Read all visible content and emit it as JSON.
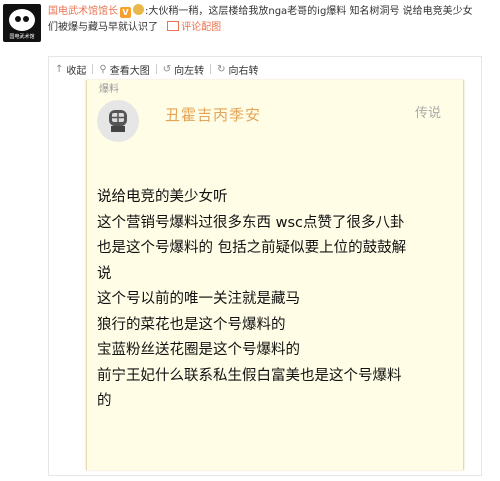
{
  "post": {
    "avatar_caption": "国电武术馆",
    "username": "国电武术馆馆长",
    "verified_badge": "V",
    "crown_icon": "crown-icon",
    "text_line1": ":大伙稍一稍，这层楼给我放nga老哥的ig爆料 知名树洞号 说给电竞美少女",
    "text_line2": "们被爆与藏马早就认识了",
    "picture_link": "评论配图"
  },
  "toolbar": {
    "collapse": "收起",
    "view_large": "查看大图",
    "rotate_left": "向左转",
    "rotate_right": "向右转",
    "collapse_icon": "arrow-up-icon",
    "search_icon": "search-icon",
    "rotate_left_icon": "rotate-left-icon",
    "rotate_right_icon": "rotate-right-icon"
  },
  "image": {
    "top_tab": "爆料",
    "nickname": "丑霍吉丙季安",
    "corner_text": "传说",
    "lines": [
      "说给电竞的美少女听",
      "这个营销号爆料过很多东西 wsc点赞了很多八卦",
      "也是这个号爆料的 包括之前疑似要上位的鼓鼓解",
      "说",
      "这个号以前的唯一关注就是藏马",
      "狼行的菜花也是这个号爆料的",
      "宝蓝粉丝送花圈是这个号爆料的",
      "前宁王妃什么联系私生假白富美也是这个号爆料",
      "的"
    ]
  }
}
